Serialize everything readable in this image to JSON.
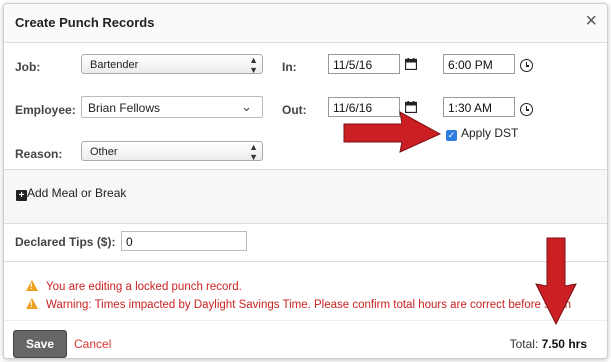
{
  "dialog": {
    "title": "Create Punch Records",
    "close_glyph": "×"
  },
  "form": {
    "job_label": "Job:",
    "job_value": "Bartender",
    "employee_label": "Employee:",
    "employee_value": "Brian Fellows",
    "reason_label": "Reason:",
    "reason_value": "Other",
    "in_label": "In:",
    "in_date": "11/5/16",
    "in_time": "6:00 PM",
    "out_label": "Out:",
    "out_date": "11/6/16",
    "out_time": "1:30 AM",
    "apply_dst_label": "Apply DST",
    "apply_dst_checked": true
  },
  "meal": {
    "add_label": "Add Meal or Break"
  },
  "tips": {
    "label": "Declared Tips ($):",
    "value": "0"
  },
  "warnings": [
    "You are editing a locked punch record.",
    "Warning: Times impacted by Daylight Savings Time. Please confirm total hours are correct before savin"
  ],
  "footer": {
    "save_label": "Save",
    "cancel_label": "Cancel",
    "total_label": "Total:",
    "total_value": "7.50 hrs"
  },
  "icons": {
    "calendar": "calendar-icon",
    "clock": "clock-icon",
    "warning": "warning-icon",
    "plus": "plus-icon",
    "annotation_arrow": "red-arrow"
  },
  "colors": {
    "accent_red": "#cc1f24",
    "warning_text": "#cc2222",
    "warning_icon": "#f0a020",
    "checkbox_blue": "#2f7de1",
    "save_button": "#666666"
  }
}
